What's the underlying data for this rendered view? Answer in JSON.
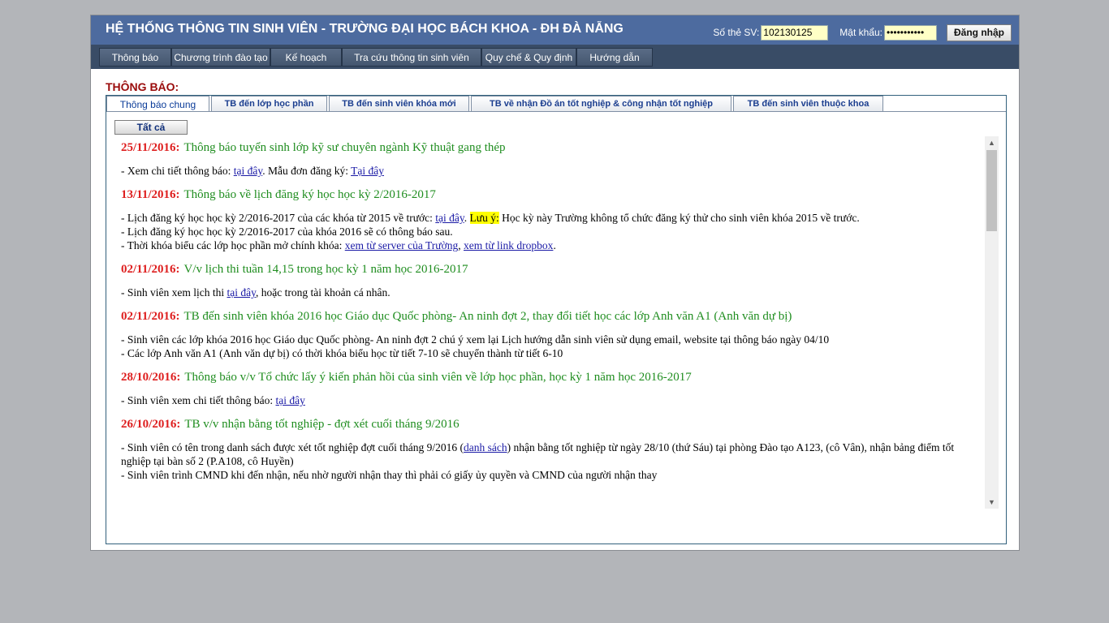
{
  "header": {
    "title": "HỆ THỐNG THÔNG TIN SINH VIÊN - TRƯỜNG ĐẠI HỌC BÁCH KHOA - ĐH ĐÀ NẴNG",
    "login": {
      "student_id_label": "Số thẻ SV:",
      "student_id_value": "102130125",
      "password_label": "Mật khẩu:",
      "password_value": "•••••••••••",
      "login_button": "Đăng nhập"
    }
  },
  "nav": {
    "items": [
      {
        "label": "Thông báo"
      },
      {
        "label": "Chương trình đào tạo"
      },
      {
        "label": "Kế hoạch"
      },
      {
        "label": "Tra cứu thông tin sinh viên"
      },
      {
        "label": "Quy chế & Quy định"
      },
      {
        "label": "Hướng dẫn"
      }
    ]
  },
  "notices": {
    "heading": "THÔNG BÁO:",
    "tabs": [
      {
        "label": "Thông báo chung"
      },
      {
        "label": "TB đến lớp học phần"
      },
      {
        "label": "TB đến sinh viên khóa mới"
      },
      {
        "label": "TB về nhận Đồ án tốt nghiệp & công nhận tốt nghiệp"
      },
      {
        "label": "TB đến sinh viên thuộc khoa"
      }
    ],
    "filter_all": "Tất cả",
    "items": [
      {
        "date": "25/11/2016:",
        "title": "Thông báo tuyển sinh lớp kỹ sư chuyên ngành Kỹ thuật gang thép",
        "line1_text": "- Xem chi tiết thông báo: ",
        "line1_link": "tại đây",
        "line1_text2": ". Mẫu đơn đăng ký: ",
        "line1_link2": "Tại đây"
      },
      {
        "date": "13/11/2016:",
        "title": "Thông báo về lịch đăng ký học học kỳ 2/2016-2017",
        "line1_text": "- Lịch đăng ký học học kỳ 2/2016-2017 của các khóa từ 2015 về trước: ",
        "line1_link": "tại đây",
        "line1_text2": ". ",
        "line1_highlight": "Lưu ý:",
        "line1_text3": " Học kỳ này Trường không tổ chức đăng ký thử cho sinh viên khóa 2015 về trước.",
        "line2": "- Lịch đăng ký học học kỳ 2/2016-2017 của khóa 2016 sẽ có thông báo sau.",
        "line3_text": "- Thời khóa biểu các lớp học phần mở chính khóa: ",
        "line3_link": "xem từ server của Trường",
        "line3_sep": ", ",
        "line3_link2": "xem từ link dropbox",
        "line3_end": "."
      },
      {
        "date": "02/11/2016:",
        "title": "V/v lịch thi tuần 14,15 trong học kỳ 1 năm học 2016-2017",
        "line1_text": "- Sinh viên xem lịch thi ",
        "line1_link": "tại đây",
        "line1_text2": ", hoặc trong tài khoản cá nhân."
      },
      {
        "date": "02/11/2016:",
        "title": "TB đến sinh viên khóa 2016 học Giáo dục Quốc phòng- An ninh đợt 2, thay đổi tiết học các lớp Anh văn A1 (Anh văn dự bị)",
        "line1": "- Sinh viên các lớp khóa 2016 học Giáo dục Quốc phòng- An ninh đợt 2 chú ý xem lại Lịch hướng dẫn sinh viên sử dụng email, website tại thông báo ngày 04/10",
        "line2": "- Các lớp Anh văn A1 (Anh văn dự bị) có thời khóa biểu học từ tiết 7-10 sẽ chuyển thành từ tiết 6-10"
      },
      {
        "date": "28/10/2016:",
        "title": "Thông báo v/v Tổ chức lấy ý kiến phản hồi của sinh viên về lớp học phần, học kỳ 1 năm học 2016-2017",
        "line1_text": "- Sinh viên xem chi tiết thông báo: ",
        "line1_link": "tại đây"
      },
      {
        "date": "26/10/2016:",
        "title": "TB v/v nhận bằng tốt nghiệp - đợt xét cuối tháng 9/2016",
        "line1_text": "- Sinh viên có tên trong danh sách được xét tốt nghiệp đợt cuối tháng 9/2016 (",
        "line1_link": "danh sách",
        "line1_text2": ") nhận bằng tốt nghiệp từ ngày 28/10 (thứ Sáu) tại phòng Đào tạo A123, (cô Vân), nhận bảng điểm tốt nghiệp tại bàn số 2 (P.A108, cô Huyền)",
        "line2": "- Sinh viên trình CMND khi đến nhận, nếu nhờ người nhận thay thì phải có giấy ủy quyền và CMND của người nhận thay"
      }
    ]
  }
}
